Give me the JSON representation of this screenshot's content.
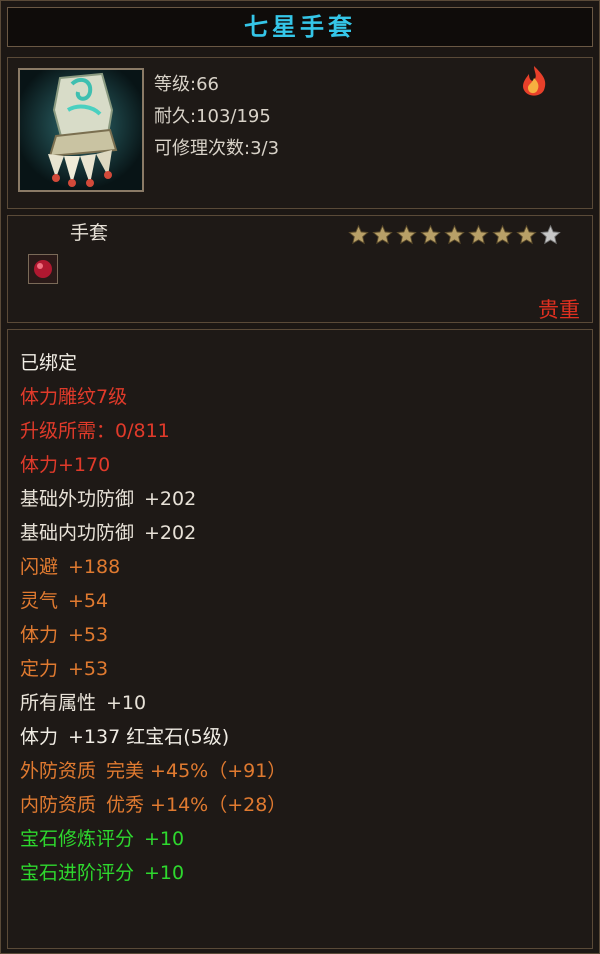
{
  "item": {
    "name": "七星手套",
    "stats": {
      "level": "等级:66",
      "durability": "耐久:103/195",
      "repairs": "可修理次数:3/3"
    },
    "type": "手套",
    "rarity": "贵重",
    "stars_total": 9,
    "stars_filled": 8,
    "colors": {
      "title": "#35c6e8",
      "red": "#e03a2a",
      "orange": "#e07a30",
      "green": "#2ed82e",
      "star_filled": "#b8a068",
      "star_empty": "#c8c8c8"
    }
  },
  "attributes": [
    {
      "label": "已绑定",
      "value": "",
      "color": "white"
    },
    {
      "label": "体力雕纹7级",
      "value": "",
      "color": "red"
    },
    {
      "label": "升级所需：0/811",
      "value": "",
      "color": "red"
    },
    {
      "label": "体力+170",
      "value": "",
      "color": "red"
    },
    {
      "label": "基础外功防御",
      "value": "+202",
      "color": "light"
    },
    {
      "label": "基础内功防御",
      "value": "+202",
      "color": "light"
    },
    {
      "label": "闪避",
      "value": "+188",
      "color": "orange"
    },
    {
      "label": "灵气",
      "value": "+54",
      "color": "orange"
    },
    {
      "label": "体力",
      "value": "+53",
      "color": "orange"
    },
    {
      "label": "定力",
      "value": "+53",
      "color": "orange"
    },
    {
      "label": "所有属性",
      "value": "+10",
      "color": "light"
    },
    {
      "label": "体力",
      "value": "+137 红宝石(5级)",
      "color": "white"
    },
    {
      "label": "外防资质",
      "value": "完美 +45%（+91）",
      "color": "orange"
    },
    {
      "label": "内防资质",
      "value": "优秀 +14%（+28）",
      "color": "orange"
    },
    {
      "label": "宝石修炼评分",
      "value": "+10",
      "color": "green"
    },
    {
      "label": "宝石进阶评分",
      "value": "+10",
      "color": "green"
    }
  ],
  "icons": {
    "item": "gauntlet-icon",
    "corner": "fire-emblem-icon",
    "gem": "ruby-gem-icon",
    "star": "star-icon"
  }
}
